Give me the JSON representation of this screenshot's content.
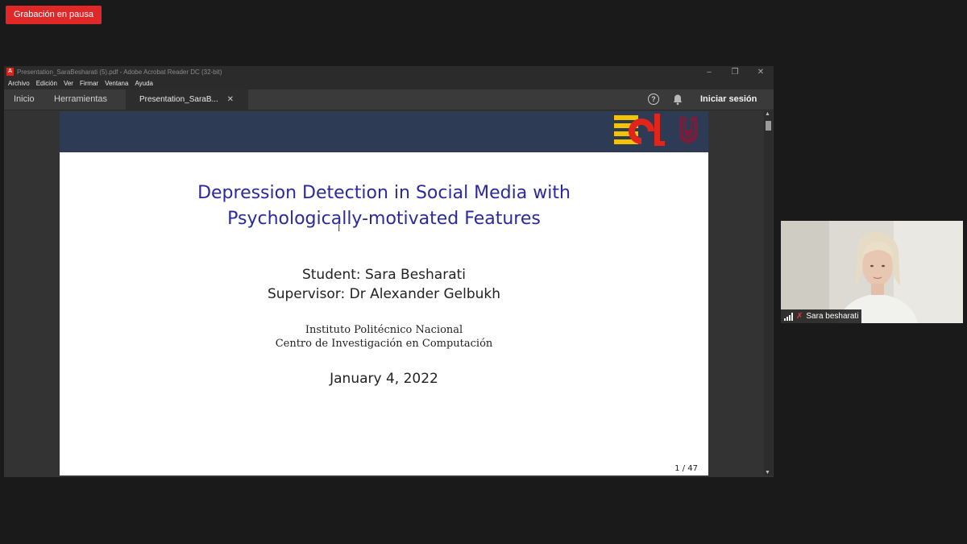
{
  "recording": {
    "label": "Grabación en pausa"
  },
  "window": {
    "title": "Presentation_SaraBesharati (5).pdf - Adobe Acrobat Reader DC (32-bit)",
    "app_icon": "acrobat-icon",
    "controls": {
      "minimize": "–",
      "restore": "❐",
      "close": "✕"
    }
  },
  "menu": [
    "Archivo",
    "Edición",
    "Ver",
    "Firmar",
    "Ventana",
    "Ayuda"
  ],
  "tabs": {
    "home": "Inicio",
    "tools": "Herramientas",
    "doc": "Presentation_SaraB...",
    "close_glyph": "✕"
  },
  "toolbar": {
    "help_glyph": "?",
    "signin": "Iniciar sesión"
  },
  "slide": {
    "title_line1": "Depression Detection in Social Media with",
    "title_line2": "Psychologically-motivated Features",
    "student": "Student: Sara Besharati",
    "supervisor": "Supervisor: Dr Alexander Gelbukh",
    "institution": "Instituto Politécnico Nacional",
    "center": "Centro de Investigación en Computación",
    "date": "January 4, 2022",
    "page": "1 / 47"
  },
  "participant": {
    "name": "Sara besharati"
  },
  "colors": {
    "recording": "#e02828",
    "slide_header": "#2e3b54",
    "slide_title": "#2a2a9e",
    "logo_yellow": "#f5c400",
    "logo_red": "#e1251b",
    "logo_maroon": "#7a1d3a"
  }
}
